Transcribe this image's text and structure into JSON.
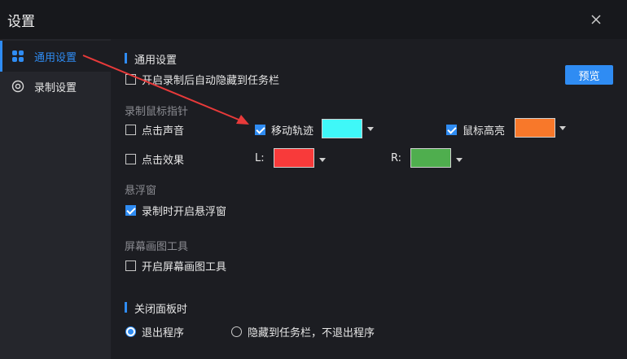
{
  "window": {
    "title": "设置"
  },
  "sidebar": {
    "items": [
      {
        "label": "通用设置",
        "icon": "grid-icon",
        "active": true
      },
      {
        "label": "录制设置",
        "icon": "record-icon",
        "active": false
      }
    ]
  },
  "general": {
    "title": "通用设置",
    "auto_hide": {
      "label": "开启录制后自动隐藏到任务栏",
      "checked": false
    },
    "preview_label": "预览"
  },
  "mouse": {
    "group_label": "录制鼠标指针",
    "click_sound": {
      "label": "点击声音",
      "checked": false
    },
    "trail": {
      "label": "移动轨迹",
      "checked": true,
      "color": "#3ff8f8"
    },
    "highlight": {
      "label": "鼠标高亮",
      "checked": true,
      "color": "#f8782a"
    },
    "click_effect": {
      "label": "点击效果",
      "checked": false
    },
    "left_label": "L:",
    "left_color": "#f83a3a",
    "right_label": "R:",
    "right_color": "#4fae4e"
  },
  "float": {
    "group_label": "悬浮窗",
    "enable": {
      "label": "录制时开启悬浮窗",
      "checked": true
    }
  },
  "draw": {
    "group_label": "屏幕画图工具",
    "enable": {
      "label": "开启屏幕画图工具",
      "checked": false
    }
  },
  "close_panel": {
    "title": "关闭面板时",
    "options": [
      {
        "label": "退出程序",
        "selected": true
      },
      {
        "label": "隐藏到任务栏，不退出程序",
        "selected": false
      }
    ]
  },
  "colors": {
    "accent": "#2f8cf3",
    "annotation_arrow": "#e83a3a"
  }
}
